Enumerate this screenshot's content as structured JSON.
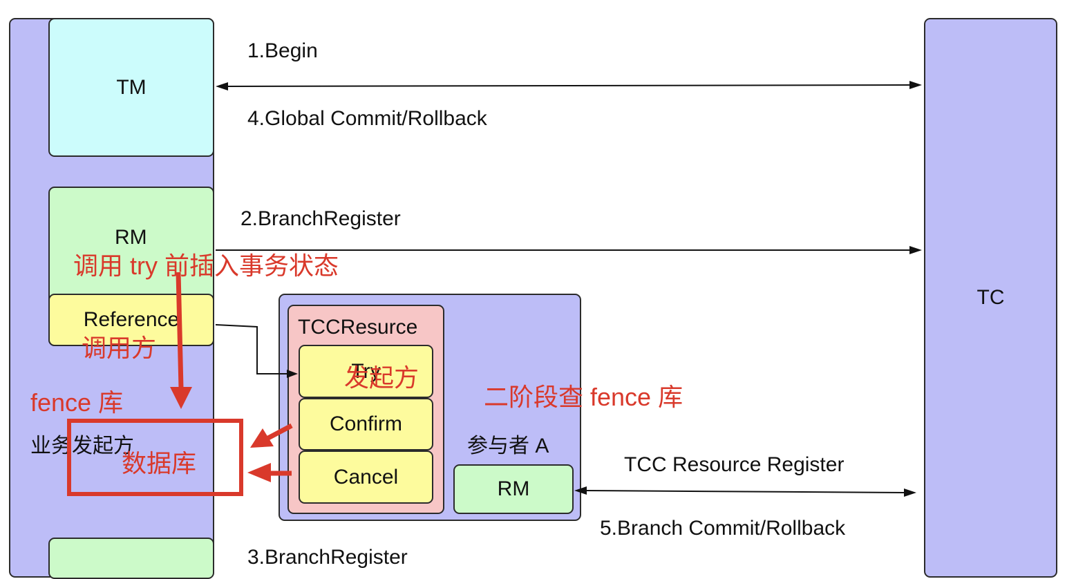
{
  "left_column": {
    "label": "业务发起方"
  },
  "tm_box": {
    "label": "TM"
  },
  "rm_box": {
    "label": "RM"
  },
  "reference_box": {
    "label": "Reference"
  },
  "tc_column": {
    "label": "TC"
  },
  "participant": {
    "label": "参与者 A",
    "tcc_resource": {
      "title": "TCCResurce",
      "methods": [
        "Try",
        "Confirm",
        "Cancel"
      ]
    },
    "rm_label": "RM"
  },
  "arrows": {
    "begin": "1.Begin",
    "global_commit": "4.Global Commit/Rollback",
    "branch_register_2": "2.BranchRegister",
    "branch_register_3": "3.BranchRegister",
    "tcc_resource_register": "TCC Resource Register",
    "branch_commit": "5.Branch Commit/Rollback"
  },
  "annotations": {
    "insert_state": "调用 try 前插入事务状态",
    "caller": "调用方",
    "fence_db": "fence 库",
    "database": "数据库",
    "initiator": "发起方",
    "phase_two": "二阶段查 fence 库"
  },
  "colors": {
    "column_fill": "#bdbdf7",
    "tm_fill": "#ccfcfc",
    "rm_fill": "#ccfac9",
    "reference_fill": "#fdfb9d",
    "tcc_fill": "#f7c6c6",
    "method_fill": "#fdfb9d",
    "annotation_red": "#d9392b"
  }
}
